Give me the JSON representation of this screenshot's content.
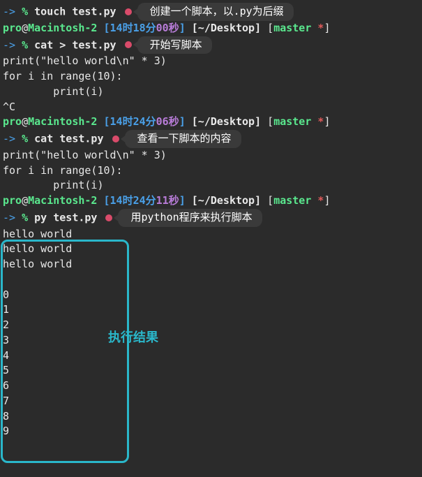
{
  "prompts": [
    {
      "arrow": "->",
      "percent": "%",
      "cmd": "touch test.py",
      "dot": true,
      "annotation": "创建一个脚本，以.py为后缀"
    },
    {
      "user": "pro",
      "at": "@",
      "host": "Macintosh-2",
      "time1": "[14时18分",
      "time2": "00秒",
      "time3": "]",
      "path": " [~/Desktop] ",
      "branch_open": "[",
      "branch": "master ",
      "star": "*",
      "branch_close": "]"
    },
    {
      "arrow": "->",
      "percent": "%",
      "cmd": "cat > test.py",
      "dot": true,
      "annotation": "开始写脚本"
    }
  ],
  "script1": [
    "print(\"hello world\\n\" * 3)",
    "for i in range(10):",
    "        print(i)",
    "^C"
  ],
  "prompts2": [
    {
      "user": "pro",
      "at": "@",
      "host": "Macintosh-2",
      "time1": "[14时24分",
      "time2": "06秒",
      "time3": "]",
      "path": " [~/Desktop] ",
      "branch_open": "[",
      "branch": "master ",
      "star": "*",
      "branch_close": "]"
    },
    {
      "arrow": "->",
      "percent": "%",
      "cmd": "cat test.py",
      "dot": true,
      "annotation": "查看一下脚本的内容"
    }
  ],
  "script2": [
    "print(\"hello world\\n\" * 3)",
    "for i in range(10):",
    "        print(i)"
  ],
  "prompts3": [
    {
      "user": "pro",
      "at": "@",
      "host": "Macintosh-2",
      "time1": "[14时24分",
      "time2": "11秒",
      "time3": "]",
      "path": " [~/Desktop] ",
      "branch_open": "[",
      "branch": "master ",
      "star": "*",
      "branch_close": "]"
    },
    {
      "arrow": "->",
      "percent": "%",
      "cmd": "py test.py",
      "dot": true,
      "annotation": "用python程序来执行脚本"
    }
  ],
  "output": [
    "hello world",
    "hello world",
    "hello world",
    "",
    "0",
    "1",
    "2",
    "3",
    "4",
    "5",
    "6",
    "7",
    "8",
    "9"
  ],
  "result_label": "执行结果"
}
